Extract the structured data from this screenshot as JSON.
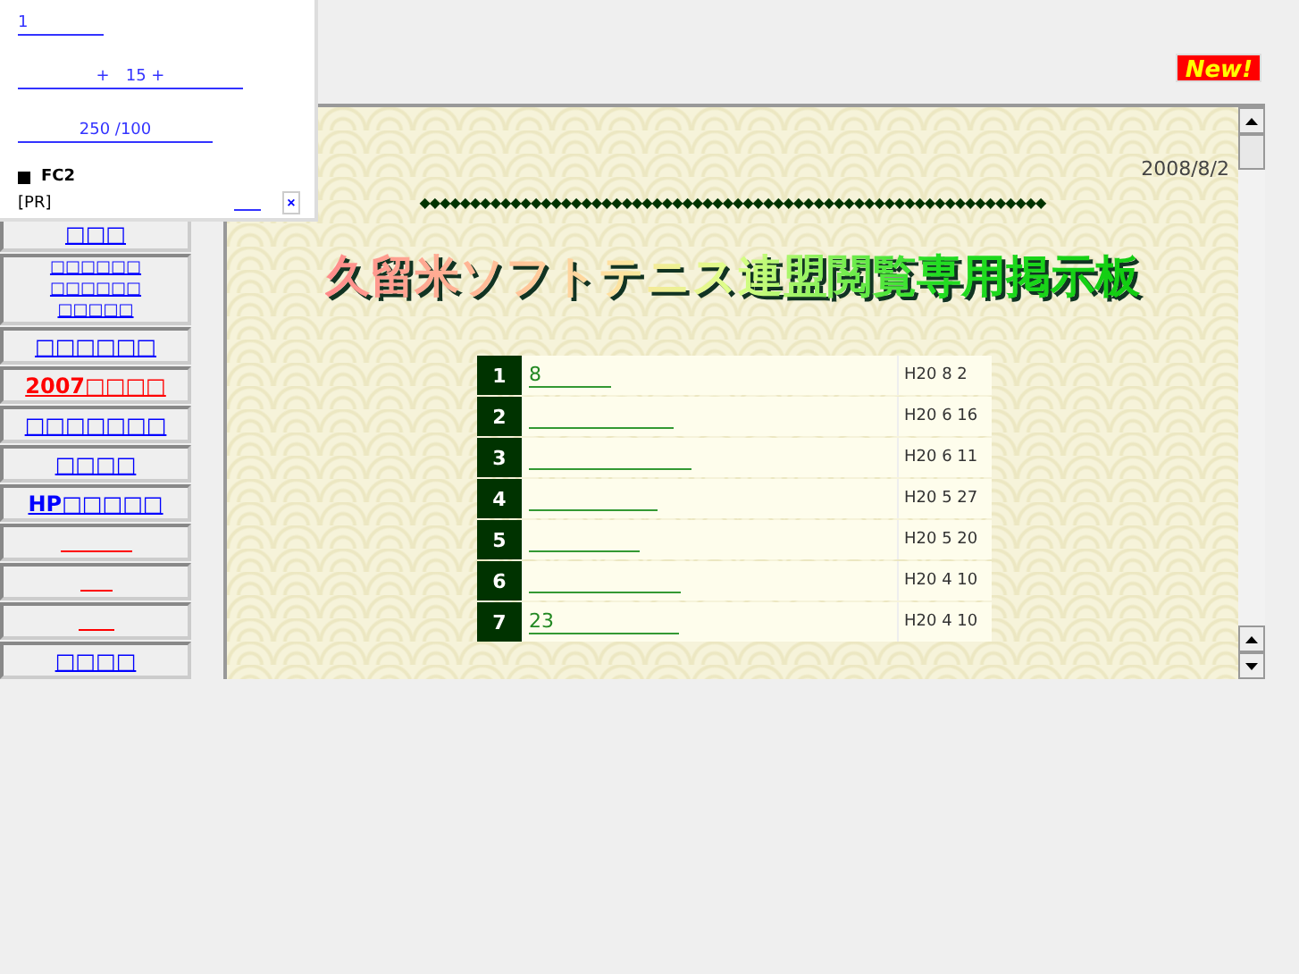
{
  "popup": {
    "links": [
      "1",
      "+　15 +",
      "250 /100"
    ],
    "brand": "FC2",
    "pr": "[PR]",
    "close": "×"
  },
  "badge": "New!",
  "sidebar": [
    {
      "kind": "link",
      "color": "#0000ff",
      "lines": [
        "□□□"
      ]
    },
    {
      "kind": "link",
      "color": "#0000ff",
      "lines": [
        "□□□□□□",
        "□□□□□□",
        "□□□□□"
      ]
    },
    {
      "kind": "link",
      "color": "#0000ff",
      "lines": [
        "□□□□□□"
      ]
    },
    {
      "kind": "link",
      "color": "#ff0000",
      "lines": [
        "2007□□□□"
      ]
    },
    {
      "kind": "link",
      "color": "#0000ff",
      "lines": [
        "□□□□□□□"
      ]
    },
    {
      "kind": "link",
      "color": "#0000ff",
      "lines": [
        "□□□□"
      ]
    },
    {
      "kind": "link",
      "color": "#0000ff",
      "lines": [
        "HP□□□□□"
      ]
    },
    {
      "kind": "blank",
      "color": "#ff0000"
    },
    {
      "kind": "blank",
      "color": "#ff0000"
    },
    {
      "kind": "blank",
      "color": "#ff0000"
    },
    {
      "kind": "link",
      "color": "#0000ff",
      "lines": [
        "□□□□"
      ]
    }
  ],
  "main": {
    "date": "2008/8/2",
    "divider": "◆◆◆◆◆◆◆◆◆◆◆◆◆◆◆◆◆◆◆◆◆◆◆◆◆◆◆◆◆◆◆◆◆◆◆◆◆◆◆◆◆◆◆◆◆◆◆◆◆◆◆◆◆◆◆◆◆◆◆◆◆◆",
    "title": "久留米ソフトテニス連盟閲覧専用掲示板",
    "rows": [
      {
        "no": "1",
        "link": "8",
        "date": "H20 8 2"
      },
      {
        "no": "2",
        "date": "H20 6 16"
      },
      {
        "no": "3",
        "date": "H20 6 11"
      },
      {
        "no": "4",
        "date": "H20 5 27"
      },
      {
        "no": "5",
        "date": "H20 5 20"
      },
      {
        "no": "6",
        "date": "H20 4 10"
      },
      {
        "no": "7",
        "link": "23",
        "date": "H20 4 10"
      }
    ]
  }
}
